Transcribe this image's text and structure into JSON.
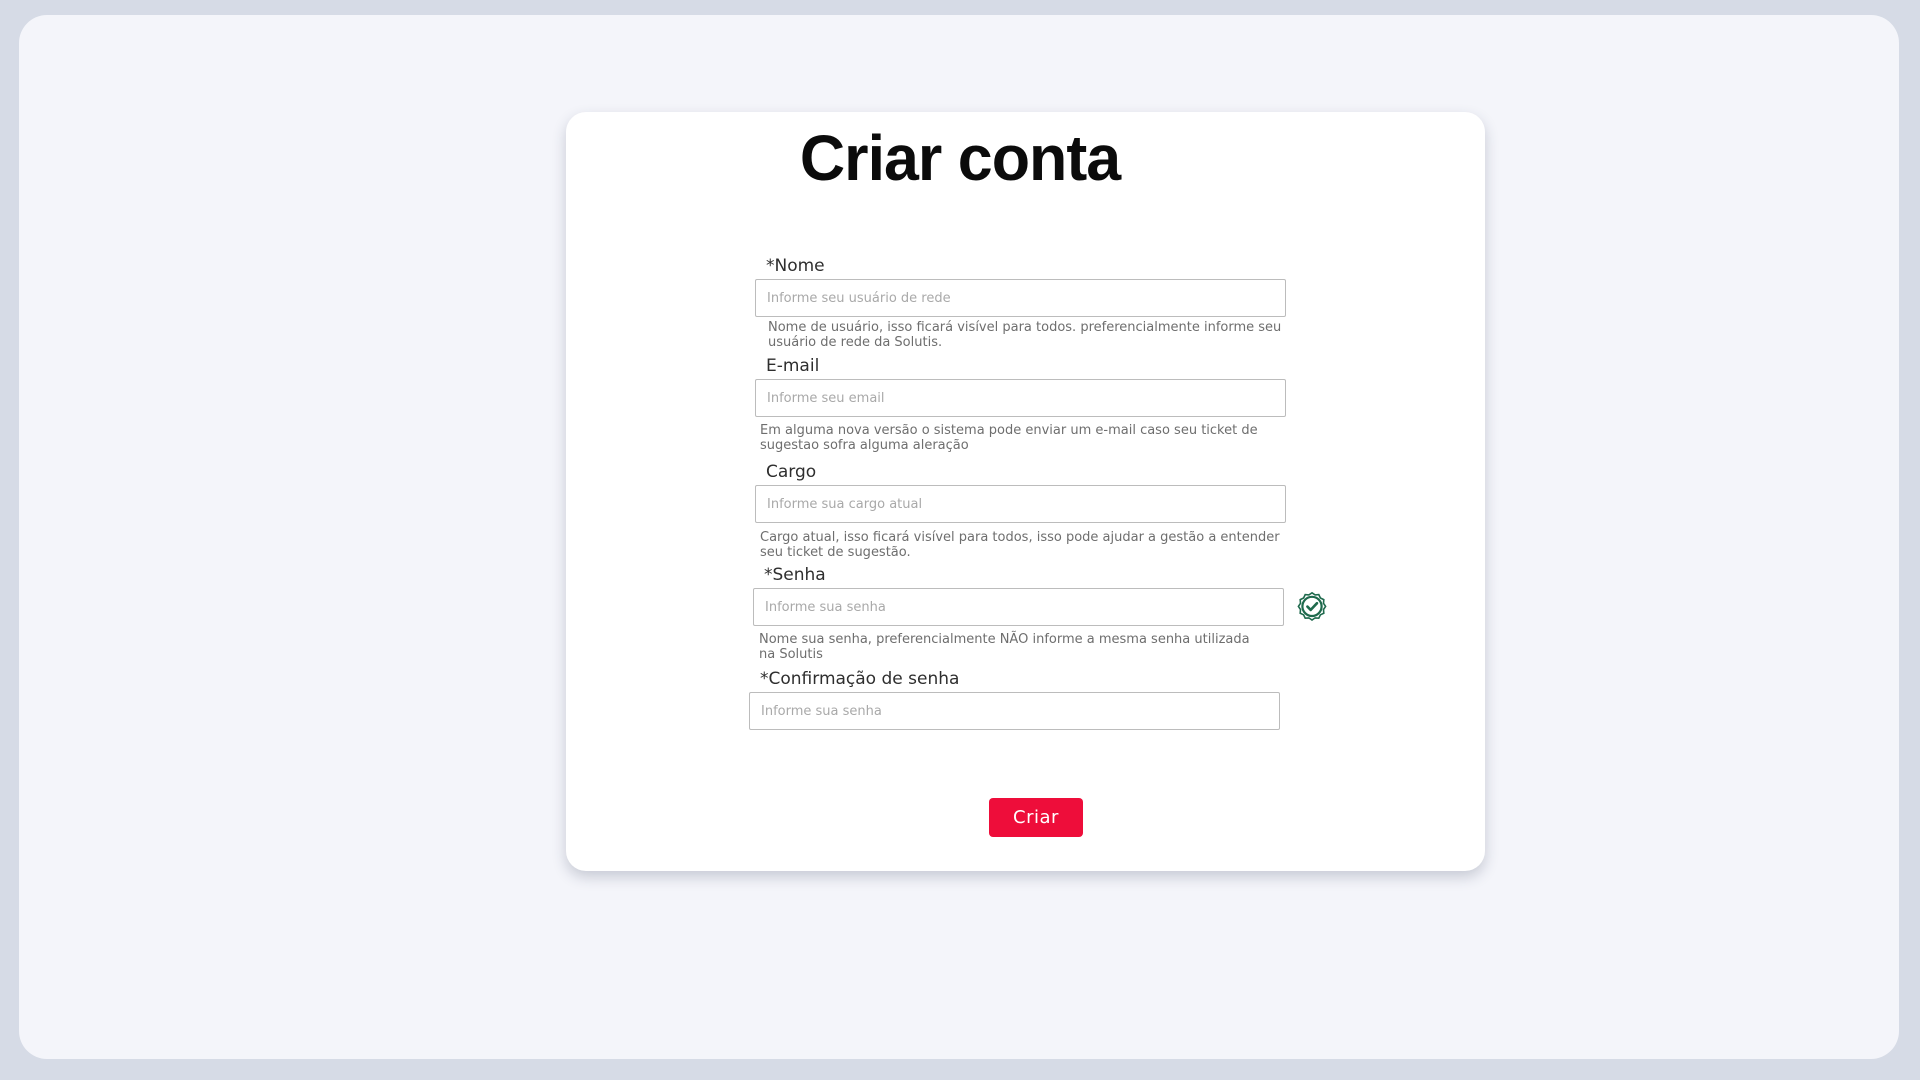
{
  "page": {
    "title": "Criar conta"
  },
  "form": {
    "fields": [
      {
        "label": "*Nome",
        "placeholder": "Informe seu usuário de rede",
        "value": "",
        "help": "Nome de usuário, isso ficará visível para todos. preferencialmente informe seu usuário de rede da Solutis."
      },
      {
        "label": "E-mail",
        "placeholder": "Informe seu email",
        "value": "",
        "help": "Em alguma nova versão o sistema pode enviar um e-mail caso seu ticket de sugestao sofra alguma aleração"
      },
      {
        "label": "Cargo",
        "placeholder": "Informe sua cargo atual",
        "value": "",
        "help": "Cargo atual, isso ficará visível para todos, isso pode ajudar a gestão a entender seu ticket de sugestão."
      },
      {
        "label": "*Senha",
        "placeholder": "Informe sua senha",
        "value": "",
        "help": "Nome sua senha, preferencialmente NÃO informe a mesma senha utilizada na Solutis",
        "status_icon": "check-badge-icon"
      },
      {
        "label": "*Confirmação de senha",
        "placeholder": "Informe sua senha",
        "value": ""
      }
    ],
    "submit_label": "Criar"
  },
  "colors": {
    "background": "#d6dbe6",
    "frame": "#f4f5fa",
    "card": "#ffffff",
    "accent": "#ee0d3a",
    "success": "#1f6a4d"
  }
}
